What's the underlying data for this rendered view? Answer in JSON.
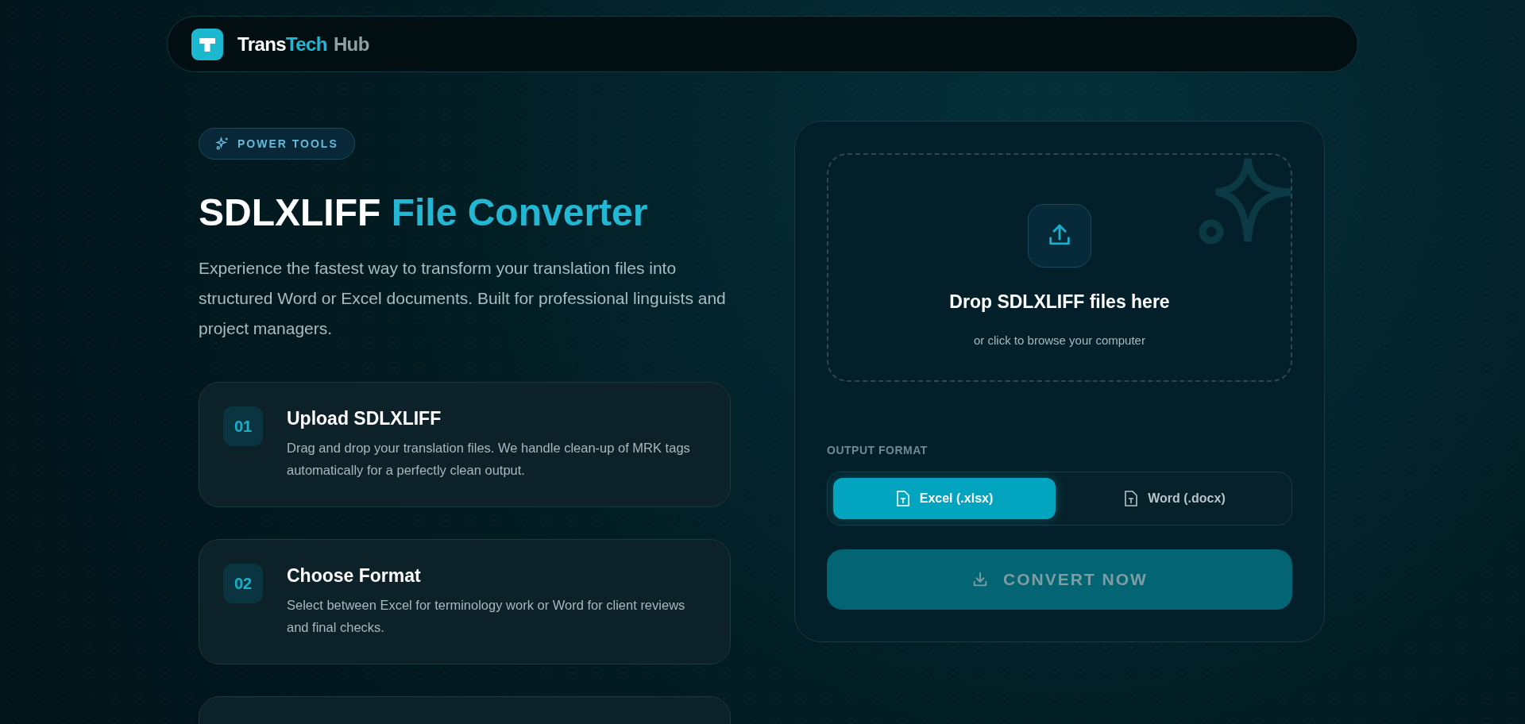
{
  "header": {
    "brand": [
      {
        "text": "Trans",
        "kind": "plain"
      },
      {
        "text": "Tech",
        "kind": "accent"
      },
      {
        "text": "Hub",
        "kind": "muted"
      }
    ]
  },
  "hero": {
    "badge": "POWER TOOLS",
    "title_lead": "SDLXLIFF",
    "title_accent": "File Converter",
    "description": "Experience the fastest way to transform your translation files into structured Word or Excel documents. Built for professional linguists and project managers."
  },
  "steps": [
    {
      "number": "01",
      "title": "Upload SDLXLIFF",
      "text": "Drag and drop your translation files. We handle clean-up of MRK tags automatically for a perfectly clean output."
    },
    {
      "number": "02",
      "title": "Choose Format",
      "text": "Select between Excel for terminology work or Word for client reviews and final checks."
    }
  ],
  "converter": {
    "dropzone": {
      "title": "Drop SDLXLIFF files here",
      "subtitle": "or click to browse your computer"
    },
    "output_label": "OUTPUT FORMAT",
    "formats": [
      {
        "label": "Excel (.xlsx)",
        "selected": true
      },
      {
        "label": "Word (.docx)",
        "selected": false
      }
    ],
    "convert_button": {
      "label": "CONVERT NOW",
      "disabled": true
    }
  }
}
